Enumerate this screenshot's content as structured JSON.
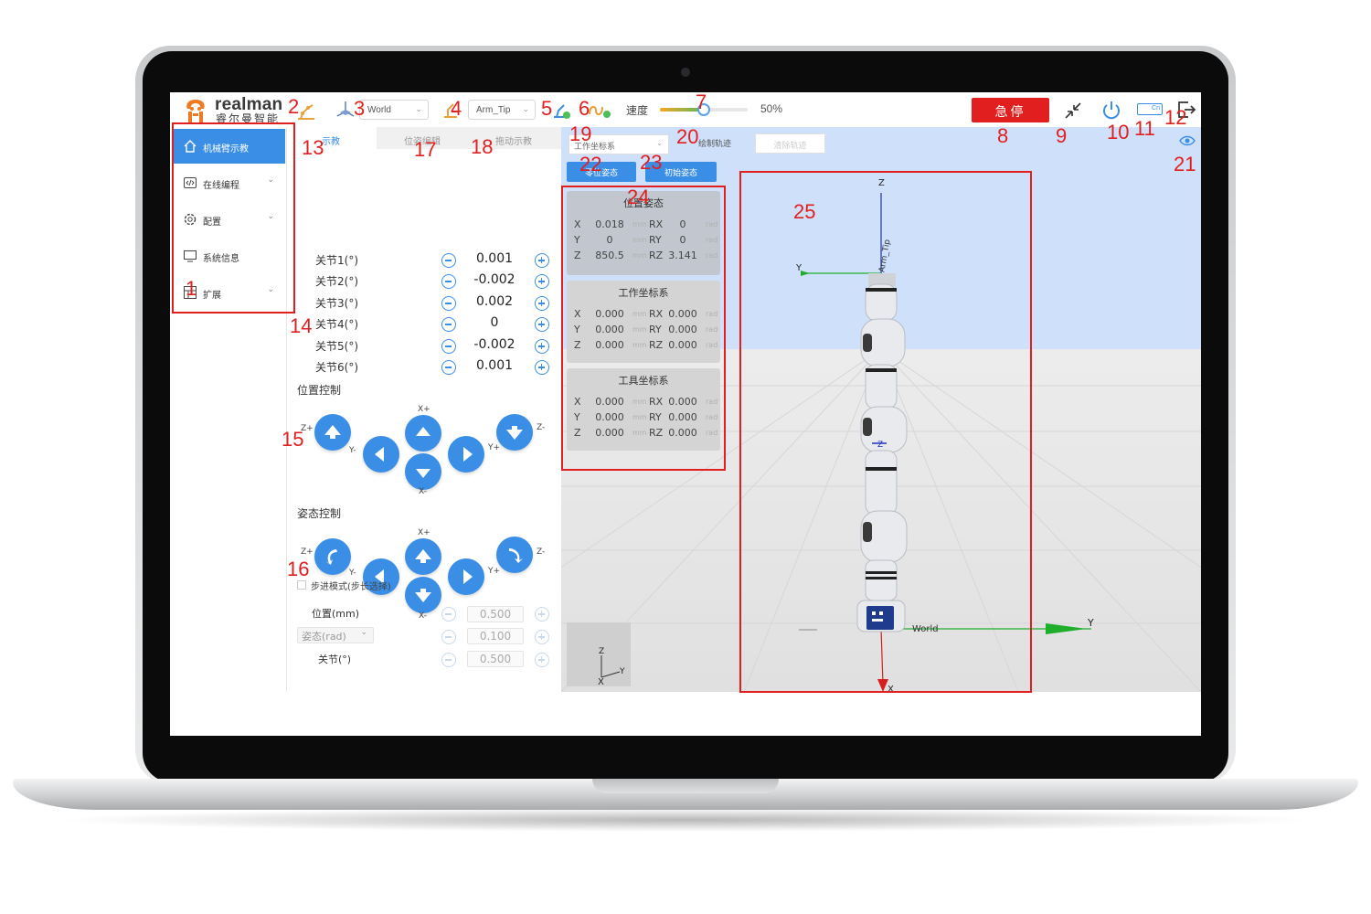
{
  "brand": {
    "logo_text": "realman",
    "logo_sub": "睿尔曼智能"
  },
  "header": {
    "world_select": "World",
    "tool_select": "Arm_Tip",
    "speed_label": "速度",
    "speed_value": "50%",
    "speed_fraction": 0.5,
    "estop_label": "急停",
    "lang_badge": "Cn"
  },
  "sidebar": {
    "items": [
      {
        "label": "机械臂示教",
        "icon": "home-icon",
        "active": true
      },
      {
        "label": "在线编程",
        "icon": "code-icon"
      },
      {
        "label": "配置",
        "icon": "gear-icon"
      },
      {
        "label": "系统信息",
        "icon": "monitor-icon"
      },
      {
        "label": "扩展",
        "icon": "extension-icon"
      }
    ]
  },
  "teach": {
    "tabs": [
      "示教",
      "位姿编辑",
      "拖动示教"
    ],
    "joints": [
      {
        "label": "关节1(°)",
        "value": "0.001"
      },
      {
        "label": "关节2(°)",
        "value": "-0.002"
      },
      {
        "label": "关节3(°)",
        "value": "0.002"
      },
      {
        "label": "关节4(°)",
        "value": "0"
      },
      {
        "label": "关节5(°)",
        "value": "-0.002"
      },
      {
        "label": "关节6(°)",
        "value": "0.001"
      }
    ],
    "position_title": "位置控制",
    "orientation_title": "姿态控制",
    "axis": {
      "xp": "X+",
      "xm": "X-",
      "yp": "Y+",
      "ym": "Y-",
      "zp": "Z+",
      "zm": "Z-"
    },
    "step_mode": "步进模式(步长选择)",
    "step": {
      "position_label": "位置(mm)",
      "position_value": "0.500",
      "orientation_select": "姿态(rad)",
      "orientation_value": "0.100",
      "joint_label": "关节(°)",
      "joint_value": "0.500"
    }
  },
  "view": {
    "frame_select": "工作坐标系",
    "draw_traj": "绘制轨迹",
    "clear_traj": "清除轨迹",
    "zero_pose": "零位姿态",
    "init_pose": "初始姿态",
    "cards": [
      {
        "title": "位置姿态",
        "rows": [
          {
            "a": "X",
            "av": "0.018",
            "au": "mm",
            "b": "RX",
            "bv": "0",
            "bu": "rad"
          },
          {
            "a": "Y",
            "av": "0",
            "au": "mm",
            "b": "RY",
            "bv": "0",
            "bu": "rad"
          },
          {
            "a": "Z",
            "av": "850.5",
            "au": "mm",
            "b": "RZ",
            "bv": "3.141",
            "bu": "rad"
          }
        ]
      },
      {
        "title": "工作坐标系",
        "rows": [
          {
            "a": "X",
            "av": "0.000",
            "au": "mm",
            "b": "RX",
            "bv": "0.000",
            "bu": "rad"
          },
          {
            "a": "Y",
            "av": "0.000",
            "au": "mm",
            "b": "RY",
            "bv": "0.000",
            "bu": "rad"
          },
          {
            "a": "Z",
            "av": "0.000",
            "au": "mm",
            "b": "RZ",
            "bv": "0.000",
            "bu": "rad"
          }
        ]
      },
      {
        "title": "工具坐标系",
        "rows": [
          {
            "a": "X",
            "av": "0.000",
            "au": "mm",
            "b": "RX",
            "bv": "0.000",
            "bu": "rad"
          },
          {
            "a": "Y",
            "av": "0.000",
            "au": "mm",
            "b": "RY",
            "bv": "0.000",
            "bu": "rad"
          },
          {
            "a": "Z",
            "av": "0.000",
            "au": "mm",
            "b": "RZ",
            "bv": "0.000",
            "bu": "rad"
          }
        ]
      }
    ],
    "scene": {
      "z": "Z",
      "y": "Y",
      "x": "X",
      "tip": "Arm_Tip",
      "world": "World"
    }
  },
  "annotations": [
    "1",
    "2",
    "3",
    "4",
    "5",
    "6",
    "7",
    "8",
    "9",
    "10",
    "11",
    "12",
    "13",
    "14",
    "15",
    "16",
    "17",
    "18",
    "19",
    "20",
    "21",
    "22",
    "23",
    "24",
    "25"
  ]
}
